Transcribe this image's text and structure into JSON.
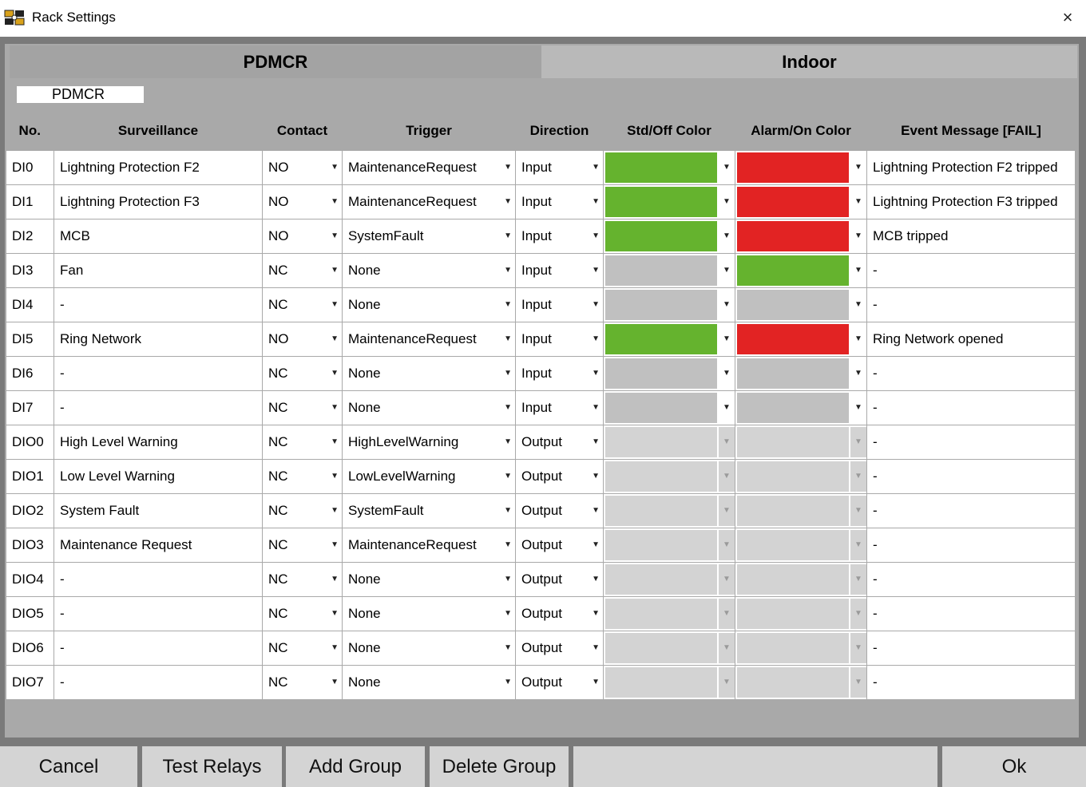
{
  "window": {
    "title": "Rack Settings",
    "close_icon": "×"
  },
  "tabs": [
    {
      "label": "PDMCR",
      "active": true
    },
    {
      "label": "Indoor",
      "active": false
    }
  ],
  "group": {
    "name": "PDMCR"
  },
  "columns": [
    "No.",
    "Surveillance",
    "Contact",
    "Trigger",
    "Direction",
    "Std/Off Color",
    "Alarm/On Color",
    "Event Message [FAIL]"
  ],
  "colors": {
    "green": "#65b32e",
    "red": "#e22323",
    "gray": "#c0c0c0",
    "disabled": "#d3d3d3"
  },
  "rows": [
    {
      "no": "DI0",
      "surveillance": "Lightning Protection F2",
      "contact": "NO",
      "trigger": "MaintenanceRequest",
      "direction": "Input",
      "std_color": "green",
      "alarm_color": "red",
      "enabled": true,
      "message": "Lightning Protection F2 tripped"
    },
    {
      "no": "DI1",
      "surveillance": "Lightning Protection F3",
      "contact": "NO",
      "trigger": "MaintenanceRequest",
      "direction": "Input",
      "std_color": "green",
      "alarm_color": "red",
      "enabled": true,
      "message": "Lightning Protection F3 tripped"
    },
    {
      "no": "DI2",
      "surveillance": "MCB",
      "contact": "NO",
      "trigger": "SystemFault",
      "direction": "Input",
      "std_color": "green",
      "alarm_color": "red",
      "enabled": true,
      "message": "MCB tripped"
    },
    {
      "no": "DI3",
      "surveillance": "Fan",
      "contact": "NC",
      "trigger": "None",
      "direction": "Input",
      "std_color": "gray",
      "alarm_color": "green",
      "enabled": true,
      "message": "-"
    },
    {
      "no": "DI4",
      "surveillance": "-",
      "contact": "NC",
      "trigger": "None",
      "direction": "Input",
      "std_color": "gray",
      "alarm_color": "gray",
      "enabled": true,
      "message": "-"
    },
    {
      "no": "DI5",
      "surveillance": "Ring Network",
      "contact": "NO",
      "trigger": "MaintenanceRequest",
      "direction": "Input",
      "std_color": "green",
      "alarm_color": "red",
      "enabled": true,
      "message": "Ring Network opened"
    },
    {
      "no": "DI6",
      "surveillance": "-",
      "contact": "NC",
      "trigger": "None",
      "direction": "Input",
      "std_color": "gray",
      "alarm_color": "gray",
      "enabled": true,
      "message": "-"
    },
    {
      "no": "DI7",
      "surveillance": "-",
      "contact": "NC",
      "trigger": "None",
      "direction": "Input",
      "std_color": "gray",
      "alarm_color": "gray",
      "enabled": true,
      "message": "-"
    },
    {
      "no": "DIO0",
      "surveillance": "High Level Warning",
      "contact": "NC",
      "trigger": "HighLevelWarning",
      "direction": "Output",
      "std_color": "disabled",
      "alarm_color": "disabled",
      "enabled": false,
      "message": "-"
    },
    {
      "no": "DIO1",
      "surveillance": "Low Level Warning",
      "contact": "NC",
      "trigger": "LowLevelWarning",
      "direction": "Output",
      "std_color": "disabled",
      "alarm_color": "disabled",
      "enabled": false,
      "message": "-"
    },
    {
      "no": "DIO2",
      "surveillance": "System Fault",
      "contact": "NC",
      "trigger": "SystemFault",
      "direction": "Output",
      "std_color": "disabled",
      "alarm_color": "disabled",
      "enabled": false,
      "message": "-"
    },
    {
      "no": "DIO3",
      "surveillance": "Maintenance Request",
      "contact": "NC",
      "trigger": "MaintenanceRequest",
      "direction": "Output",
      "std_color": "disabled",
      "alarm_color": "disabled",
      "enabled": false,
      "message": "-"
    },
    {
      "no": "DIO4",
      "surveillance": "-",
      "contact": "NC",
      "trigger": "None",
      "direction": "Output",
      "std_color": "disabled",
      "alarm_color": "disabled",
      "enabled": false,
      "message": "-"
    },
    {
      "no": "DIO5",
      "surveillance": "-",
      "contact": "NC",
      "trigger": "None",
      "direction": "Output",
      "std_color": "disabled",
      "alarm_color": "disabled",
      "enabled": false,
      "message": "-"
    },
    {
      "no": "DIO6",
      "surveillance": "-",
      "contact": "NC",
      "trigger": "None",
      "direction": "Output",
      "std_color": "disabled",
      "alarm_color": "disabled",
      "enabled": false,
      "message": "-"
    },
    {
      "no": "DIO7",
      "surveillance": "-",
      "contact": "NC",
      "trigger": "None",
      "direction": "Output",
      "std_color": "disabled",
      "alarm_color": "disabled",
      "enabled": false,
      "message": "-"
    }
  ],
  "buttons": {
    "cancel": "Cancel",
    "test_relays": "Test Relays",
    "add_group": "Add Group",
    "delete_group": "Delete Group",
    "ok": "Ok"
  }
}
